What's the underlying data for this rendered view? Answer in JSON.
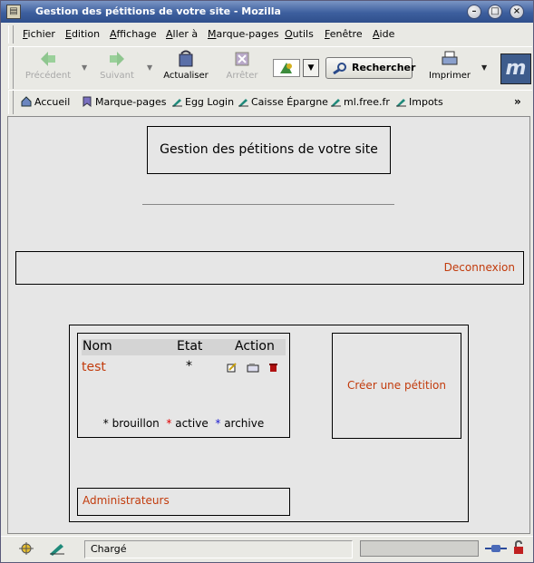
{
  "window": {
    "title": "Gestion des pétitions de votre site - Mozilla"
  },
  "menu": [
    "Fichier",
    "Edition",
    "Affichage",
    "Aller à",
    "Marque-pages",
    "Outils",
    "Fenêtre",
    "Aide"
  ],
  "toolbar": {
    "back": "Précédent",
    "forward": "Suivant",
    "reload": "Actualiser",
    "stop": "Arrêter",
    "search": "Rechercher",
    "print": "Imprimer"
  },
  "bookmarks": {
    "home": "Accueil",
    "bookmarks": "Marque-pages",
    "items": [
      "Egg Login",
      "Caisse Épargne",
      "ml.free.fr",
      "Impots"
    ],
    "more": "»"
  },
  "page": {
    "heading": "Gestion des pétitions de votre site",
    "logout": "Deconnexion",
    "table": {
      "col_name": "Nom",
      "col_state": "Etat",
      "col_action": "Action",
      "rows": [
        {
          "name": "test",
          "state": "*"
        }
      ]
    },
    "legend": {
      "draft_mark": "*",
      "draft": "brouillon",
      "active_mark": "*",
      "active": "active",
      "archive_mark": "*",
      "archive": "archive"
    },
    "create": "Créer une pétition",
    "admins": "Administrateurs"
  },
  "colors": {
    "link": "#c23b0c",
    "legend_active": "#e00000",
    "legend_archive": "#1a1ad0",
    "titlebar": "#3d5f9e"
  },
  "status": {
    "text": "Chargé",
    "progress": 0
  }
}
